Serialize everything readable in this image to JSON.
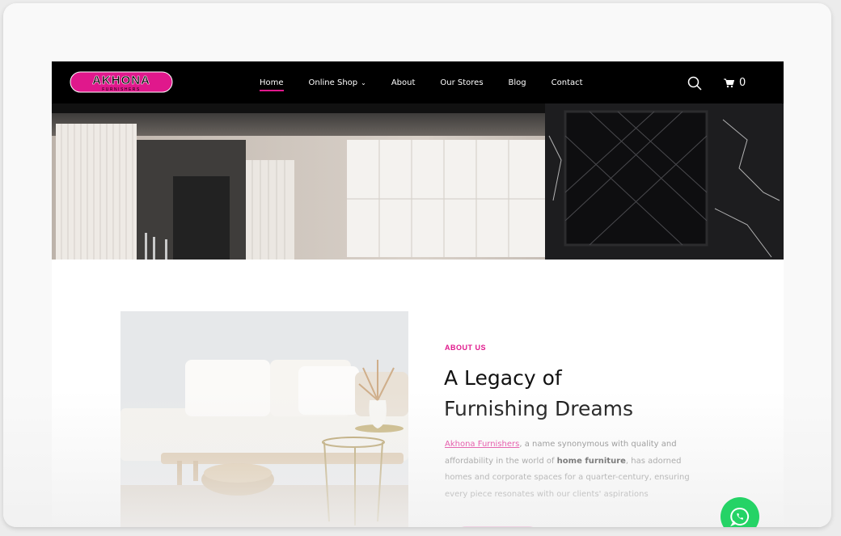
{
  "brand": {
    "logo_text": "AKHONA",
    "logo_sub": "FURNISHERS",
    "accent": "#e0188c"
  },
  "nav": {
    "items": [
      {
        "label": "Home"
      },
      {
        "label": "Online Shop"
      },
      {
        "label": "About"
      },
      {
        "label": "Our Stores"
      },
      {
        "label": "Blog"
      },
      {
        "label": "Contact"
      }
    ],
    "active": "Home",
    "cart_count": "0"
  },
  "about": {
    "eyebrow": "ABOUT US",
    "heading_line1": "A Legacy of",
    "heading_line2": "Furnishing Dreams",
    "para_link": "Akhona Furnishers",
    "para_text1": ", a name synonymous with quality and affordability in the world of ",
    "para_bold": "home furniture",
    "para_text2": ", has adorned homes and corporate spaces for a quarter-century, ensuring every piece resonates with our clients' aspirations"
  },
  "icons": {
    "search": "search-icon",
    "cart": "cart-icon",
    "chevron": "chevron-down-icon",
    "whatsapp": "whatsapp-icon"
  }
}
